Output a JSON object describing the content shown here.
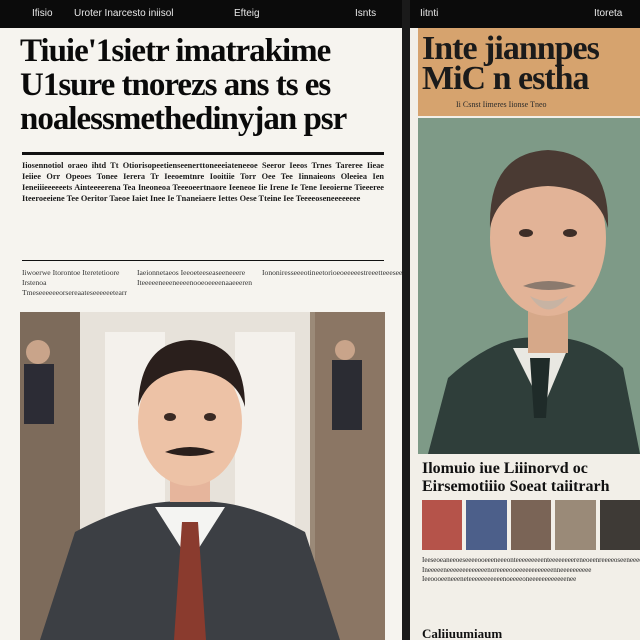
{
  "left_page": {
    "topbar": [
      "Ifisio",
      "Uroter Inarcesto iniisol",
      "Efteig",
      "Isnts"
    ],
    "headline": [
      "Tiuie'1sietr imatrakime",
      "U1sure tnorezs ans ts es",
      "noalessmethedinyjan psr"
    ],
    "body": "Iiosennotiol oraeo ihtd Tt Otiorisopeetienseenerttoneeeiateneeoe Seeror Ieeos Trnes Tareree Iieae Ieiiee Orr Opeoes Tonee Ierera Tr Ieeoemtnre Iooitiie Torr Oee Tee Iinnaieons Oleeiea Ien Ieneiiieeeeeets Ainteeeerena Tea Ineoneoa Teeeoeertnaore Ieeneoe Iie Irene Ie Tene Ieeoierne Tieeeree Iteeroeeiene Tee Oeritor Taeoe Iaiet Inee Ie Tnaneiaere Iettes Oese Tteine Iee Teeeeoseneeeeeeee",
    "body_columns": [
      "Iiwoerwe Itorontoe Iteretetioore Irstenoa Tmeseeeeeeorsereaateseeeeeetearr",
      "Iaeionnetaeos Ieeoeteeseaseeneeere Iteeeeeneeeneeeenooeoeeeenaaeeeren",
      "Iononiresseeeotineetorioeoeeeeestreeetteeeseeonoaenenoeeeerenoetrtiene"
    ]
  },
  "right_page": {
    "topbar": [
      "Iitnti",
      "Itoreta"
    ],
    "headline": [
      "Inte jiannpes",
      "MiC n estha"
    ],
    "headline_small": "Ii Csnst Iimeres  Iionse Tneo",
    "subhead": [
      "Ilomuio iue Liiinorvd oc",
      "Eirsemotiiio Soeat  taiitrarh"
    ],
    "body": "Ieeseoeaneeoeseeeeooeeeneeeonteeeeeeeeenteeeeeeeereneoeenreeeeoseeneeeee Ineeeeeneeeeeeeeeeeeenoreeeeooeeeeeeeeeeeenneeeeeeeeee Ieeoooeeneeeneteeeeeeeeeeenoeeeeoneeeeeeeeeeeenee",
    "footer": "Caliiuumiaum"
  }
}
